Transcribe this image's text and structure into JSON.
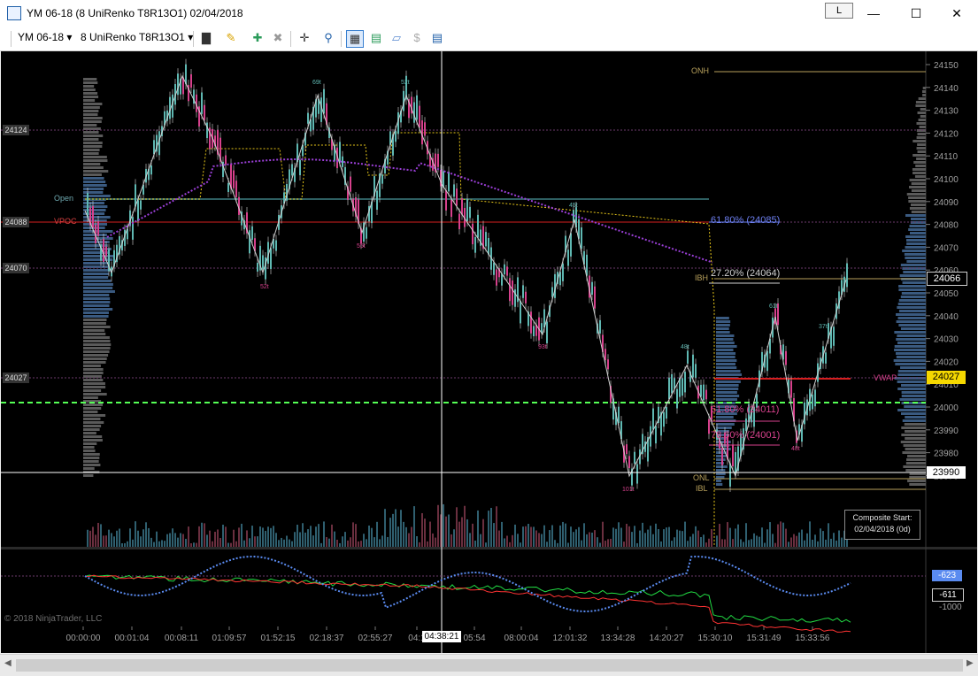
{
  "window": {
    "title": "YM 06-18 (8 UniRenko T8R13O1)  02/04/2018",
    "layout_button": "L",
    "minimize_icon": "minimize-icon",
    "maximize_icon": "maximize-icon",
    "close_icon": "close-icon"
  },
  "toolbar": {
    "instrument": "YM 06-18",
    "bar_type": "8 UniRenko T8R13O1",
    "icons": [
      "bar-style-icon",
      "pencil-draw-icon",
      "add-indicator-icon",
      "remove-icon",
      "crosshair-icon",
      "zoom-icon",
      "chart-trader-icon",
      "data-box-icon",
      "performance-icon",
      "dollar-icon",
      "properties-icon"
    ]
  },
  "chart": {
    "price_ticks": [
      "24150",
      "24140",
      "24130",
      "24120",
      "24110",
      "24100",
      "24090",
      "24080",
      "24070",
      "24060",
      "24050",
      "24040",
      "24030",
      "24020",
      "24010",
      "24000",
      "23990",
      "23980",
      "23970"
    ],
    "time_ticks": [
      "00:00:00",
      "00:01:04",
      "00:08:11",
      "01:09:57",
      "01:52:15",
      "02:18:37",
      "02:55:27",
      "04:1",
      "05:54",
      "08:00:04",
      "12:01:32",
      "13:34:28",
      "14:20:27",
      "15:30:10",
      "15:31:49",
      "15:33:56"
    ],
    "crosshair_time": "04:38:21",
    "current_price": "24066",
    "crosshair_price": "23990",
    "yellow_price_tag": "24027",
    "left_tags": {
      "level_24124": "24124",
      "level_24088": "24088",
      "level_24070": "24070",
      "level_24027": "24027"
    },
    "level_labels": {
      "open": "Open",
      "vpoc": "VPOC",
      "onh": "ONH",
      "ibh": "IBH",
      "onl": "ONL",
      "ibl": "IBL",
      "vwap": "VWAP"
    },
    "fib_labels": [
      "61.80% (24085)",
      "27.20% (24064)",
      "61.80% (24011)",
      "78.60% (24001)"
    ],
    "swing_labels": [
      "69t",
      "52t",
      "45t",
      "48t",
      "61t",
      "37t",
      "101t",
      "93t",
      "52t",
      "55t",
      "48t"
    ],
    "composite_box": {
      "line1": "Composite Start:",
      "line2": "02/04/2018 (0d)"
    },
    "copyright": "© 2018 NinjaTrader, LLC",
    "indicator_ticks": [
      "-623",
      "-611",
      "-1000"
    ],
    "colors": {
      "background": "#000000",
      "up_candle": "#5fb8b2",
      "down_candle": "#d6418c",
      "vwap": "#9b3fd8",
      "fib_blue": "#6d7ff0",
      "dashed_green": "#55ff55",
      "yellow_tag": "#f5d800",
      "open_line": "#2e5f62",
      "vpoc_line": "#d61f1f"
    }
  }
}
